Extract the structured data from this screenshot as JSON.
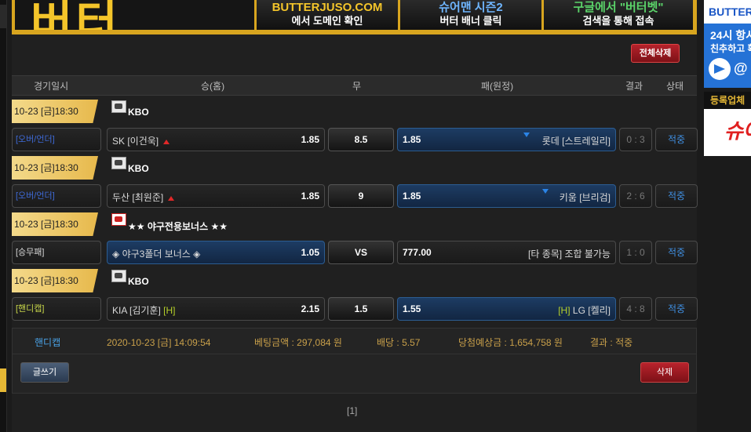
{
  "banner": {
    "logo": "버터",
    "items": [
      {
        "line1": "BUTTERJUSO.COM",
        "line2": "에서 도메인 확인"
      },
      {
        "line1": "슈어맨 시즌2",
        "line2": "버터 배너 클릭"
      },
      {
        "line1": "구글에서 \"버터벳\"",
        "line2": "검색을 통해 접속"
      }
    ]
  },
  "toolbar": {
    "delete_all": "전체삭제"
  },
  "columns": {
    "date": "경기일시",
    "home": "승(홈)",
    "draw": "무",
    "away": "패(원정)",
    "result": "결과",
    "status": "상태"
  },
  "games": [
    {
      "date": "10-23 [금]18:30",
      "league": "KBO",
      "bet_type": "[오버/언더]",
      "home_name": "SK [이건욱]",
      "home_odds": "1.85",
      "mid": "8.5",
      "away_odds": "1.85",
      "away_name": "롯데 [스트레일리]",
      "result": "0 : 3",
      "status": "적중"
    },
    {
      "date": "10-23 [금]18:30",
      "league": "KBO",
      "bet_type": "[오버/언더]",
      "home_name": "두산 [최원준]",
      "home_odds": "1.85",
      "mid": "9",
      "away_odds": "1.85",
      "away_name": "키움 [브리검]",
      "result": "2 : 6",
      "status": "적중"
    },
    {
      "date": "10-23 [금]18:30",
      "league": "★★ 야구전용보너스 ★★",
      "bet_type": "[승무패]",
      "home_name": "◈ 야구3폴더 보너스 ◈",
      "home_odds": "1.05",
      "mid": "VS",
      "away_odds": "777.00",
      "away_name": "[타 종목] 조합 불가능",
      "result": "1 : 0",
      "status": "적중"
    },
    {
      "date": "10-23 [금]18:30",
      "league": "KBO",
      "bet_type": "[핸디캡]",
      "home_name": "KIA [김기훈]",
      "home_tag": "[H]",
      "home_odds": "2.15",
      "mid": "1.5",
      "away_odds": "1.55",
      "away_tag": "[H]",
      "away_name": "LG [켈리]",
      "result": "4 : 8",
      "status": "적중"
    }
  ],
  "summary": {
    "type": "핸디캡",
    "datetime": "2020-10-23 [금] 14:09:54",
    "bet_amount": "베팅금액 : 297,084 원",
    "rate": "배당 : 5.57",
    "expected": "당첨예상금 : 1,654,758 원",
    "result": "결과 : 적중"
  },
  "actions": {
    "write": "글쓰기",
    "delete": "삭제"
  },
  "pagination": "[1]",
  "sidebar": {
    "brand": "BUTTERBET",
    "promo_line1": "24시 항시",
    "promo_line2": "친추하고 확인",
    "handle": "@",
    "registered": "등록업체",
    "ad_text": "슈어"
  }
}
